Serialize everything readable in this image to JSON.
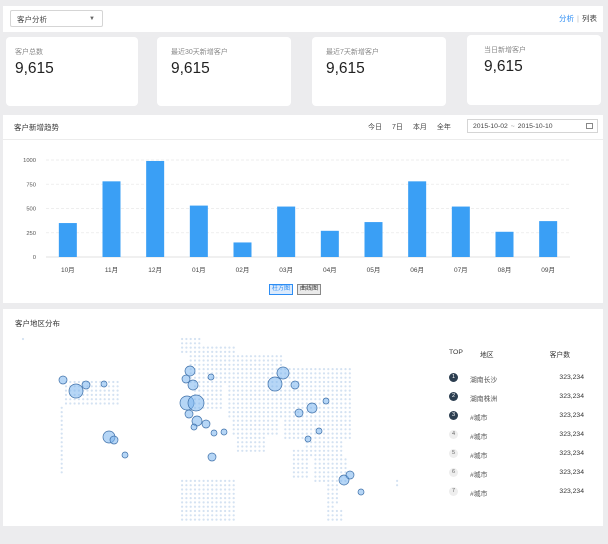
{
  "topbar": {
    "select_value": "客户分析",
    "view_active": "分析",
    "view_separator": "|",
    "view_inactive": "列表"
  },
  "stats": [
    {
      "label": "客户总数",
      "value": "9,615"
    },
    {
      "label": "最近30天新增客户",
      "value": "9,615"
    },
    {
      "label": "最近7天新增客户",
      "value": "9,615"
    },
    {
      "label": "当日新增客户",
      "value": "9,615"
    }
  ],
  "trend": {
    "title": "客户新增趋势",
    "range_tabs": [
      "今日",
      "7日",
      "本月",
      "全年"
    ],
    "date_start": "2015-10-02",
    "date_separator": "~",
    "date_end": "2015-10-10",
    "btn_bar": "柱方图",
    "btn_line": "曲线图"
  },
  "chart_data": {
    "type": "bar",
    "categories": [
      "10月",
      "11月",
      "12月",
      "01月",
      "02月",
      "03月",
      "04月",
      "05月",
      "06月",
      "07月",
      "08月",
      "09月"
    ],
    "values": [
      350,
      780,
      990,
      530,
      150,
      520,
      270,
      360,
      780,
      520,
      260,
      370
    ],
    "ylim": [
      0,
      1000
    ],
    "yticks": [
      0,
      250,
      500,
      750,
      1000
    ],
    "color": "#3a9ff5",
    "grid": true
  },
  "region": {
    "title": "客户地区分布",
    "table_headers": {
      "top": "TOP",
      "area": "地区",
      "count": "客户数"
    },
    "rows": [
      {
        "rank": "1",
        "city": "湖南长沙",
        "count": "323,234"
      },
      {
        "rank": "2",
        "city": "湖南株洲",
        "count": "323,234"
      },
      {
        "rank": "3",
        "city": "#城市",
        "count": "323,234"
      },
      {
        "rank": "4",
        "city": "#城市",
        "count": "323,234"
      },
      {
        "rank": "5",
        "city": "#城市",
        "count": "323,234"
      },
      {
        "rank": "6",
        "city": "#城市",
        "count": "323,234"
      },
      {
        "rank": "7",
        "city": "#城市",
        "count": "323,234"
      }
    ]
  }
}
